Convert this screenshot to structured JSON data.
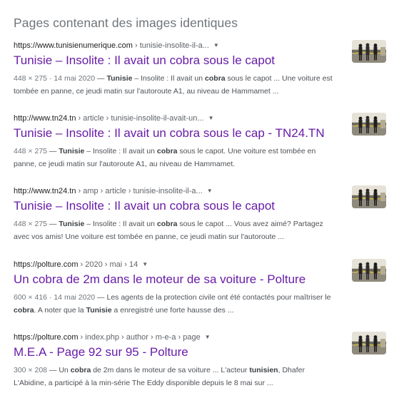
{
  "section_title": "Pages contenant des images identiques",
  "results": [
    {
      "domain": "https://www.tunisienumerique.com",
      "crumbs": " › tunisie-insolite-il-a...",
      "title": "Tunisie – Insolite : Il avait un cobra sous le capot",
      "dims": "448 × 275",
      "date": " · 14 mai 2020",
      "snippet": [
        {
          "t": " — ",
          "b": false
        },
        {
          "t": "Tunisie",
          "b": true
        },
        {
          "t": " – Insolite : Il avait un ",
          "b": false
        },
        {
          "t": "cobra",
          "b": true
        },
        {
          "t": " sous le capot ... Une voiture est tombée en panne, ce jeudi matin sur l'autoroute A1, au niveau de Hammamet ...",
          "b": false
        }
      ]
    },
    {
      "domain": "http://www.tn24.tn",
      "crumbs": " › article › tunisie-insolite-il-avait-un...",
      "title": "Tunisie – Insolite : Il avait un cobra sous le cap - TN24.TN",
      "dims": "448 × 275",
      "date": "",
      "snippet": [
        {
          "t": " — ",
          "b": false
        },
        {
          "t": "Tunisie",
          "b": true
        },
        {
          "t": " – Insolite : Il avait un ",
          "b": false
        },
        {
          "t": "cobra",
          "b": true
        },
        {
          "t": " sous le capot. Une voiture est tombée en panne, ce jeudi matin sur l'autoroute A1, au niveau de Hammamet.",
          "b": false
        }
      ]
    },
    {
      "domain": "http://www.tn24.tn",
      "crumbs": " › amp › article › tunisie-insolite-il-a...",
      "title": "Tunisie – Insolite : Il avait un cobra sous le capot",
      "dims": "448 × 275",
      "date": "",
      "snippet": [
        {
          "t": " — ",
          "b": false
        },
        {
          "t": "Tunisie",
          "b": true
        },
        {
          "t": " – Insolite : Il avait un ",
          "b": false
        },
        {
          "t": "cobra",
          "b": true
        },
        {
          "t": " sous le capot ... Vous avez aimé? Partagez avec vos amis! Une voiture est tombée en panne, ce jeudi matin sur l'autoroute ...",
          "b": false
        }
      ]
    },
    {
      "domain": "https://polture.com",
      "crumbs": " › 2020 › mai › 14",
      "title": "Un cobra de 2m dans le moteur de sa voiture - Polture",
      "dims": "600 × 416",
      "date": " · 14 mai 2020",
      "snippet": [
        {
          "t": " — Les agents de la protection civile ont été contactés pour maîtriser le ",
          "b": false
        },
        {
          "t": "cobra",
          "b": true
        },
        {
          "t": ". A noter que la ",
          "b": false
        },
        {
          "t": "Tunisie",
          "b": true
        },
        {
          "t": " a enregistré une forte hausse des ...",
          "b": false
        }
      ]
    },
    {
      "domain": "https://polture.com",
      "crumbs": " › index.php › author › m-e-a › page",
      "title": "M.E.A - Page 92 sur 95 - Polture",
      "dims": "300 × 208",
      "date": "",
      "snippet": [
        {
          "t": " — Un ",
          "b": false
        },
        {
          "t": "cobra",
          "b": true
        },
        {
          "t": " de 2m dans le moteur de sa voiture ... L'acteur ",
          "b": false
        },
        {
          "t": "tunisien",
          "b": true
        },
        {
          "t": ", Dhafer L'Abidine, a participé à la min-série The Eddy disponible depuis le 8 mai sur ...",
          "b": false
        }
      ]
    }
  ],
  "icons": {
    "menu": "dropdown-arrow-icon",
    "thumbnail": "result-thumbnail"
  },
  "colors": {
    "title_visited": "#681da8",
    "meta": "#70757a",
    "snippet": "#4d5156",
    "url": "#202124"
  }
}
